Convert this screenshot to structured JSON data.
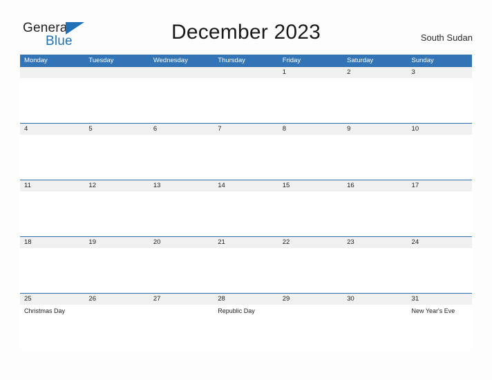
{
  "brand": {
    "name_part1": "General",
    "name_part2": "Blue",
    "triangle_color": "#1f72b8"
  },
  "header": {
    "title": "December 2023",
    "country": "South Sudan"
  },
  "colors": {
    "header_blue": "#3274b5",
    "row_divider_blue": "#2d6ca8",
    "date_band": "#f0f0f0",
    "page_background": "#fdfdfd"
  },
  "calendar": {
    "weekdays": [
      "Monday",
      "Tuesday",
      "Wednesday",
      "Thursday",
      "Friday",
      "Saturday",
      "Sunday"
    ],
    "weeks": [
      {
        "days": [
          {
            "date": "",
            "event": ""
          },
          {
            "date": "",
            "event": ""
          },
          {
            "date": "",
            "event": ""
          },
          {
            "date": "",
            "event": ""
          },
          {
            "date": "1",
            "event": ""
          },
          {
            "date": "2",
            "event": ""
          },
          {
            "date": "3",
            "event": ""
          }
        ]
      },
      {
        "days": [
          {
            "date": "4",
            "event": ""
          },
          {
            "date": "5",
            "event": ""
          },
          {
            "date": "6",
            "event": ""
          },
          {
            "date": "7",
            "event": ""
          },
          {
            "date": "8",
            "event": ""
          },
          {
            "date": "9",
            "event": ""
          },
          {
            "date": "10",
            "event": ""
          }
        ]
      },
      {
        "days": [
          {
            "date": "11",
            "event": ""
          },
          {
            "date": "12",
            "event": ""
          },
          {
            "date": "13",
            "event": ""
          },
          {
            "date": "14",
            "event": ""
          },
          {
            "date": "15",
            "event": ""
          },
          {
            "date": "16",
            "event": ""
          },
          {
            "date": "17",
            "event": ""
          }
        ]
      },
      {
        "days": [
          {
            "date": "18",
            "event": ""
          },
          {
            "date": "19",
            "event": ""
          },
          {
            "date": "20",
            "event": ""
          },
          {
            "date": "21",
            "event": ""
          },
          {
            "date": "22",
            "event": ""
          },
          {
            "date": "23",
            "event": ""
          },
          {
            "date": "24",
            "event": ""
          }
        ]
      },
      {
        "days": [
          {
            "date": "25",
            "event": "Christmas Day"
          },
          {
            "date": "26",
            "event": ""
          },
          {
            "date": "27",
            "event": ""
          },
          {
            "date": "28",
            "event": "Republic Day"
          },
          {
            "date": "29",
            "event": ""
          },
          {
            "date": "30",
            "event": ""
          },
          {
            "date": "31",
            "event": "New Year's Eve"
          }
        ]
      }
    ]
  }
}
